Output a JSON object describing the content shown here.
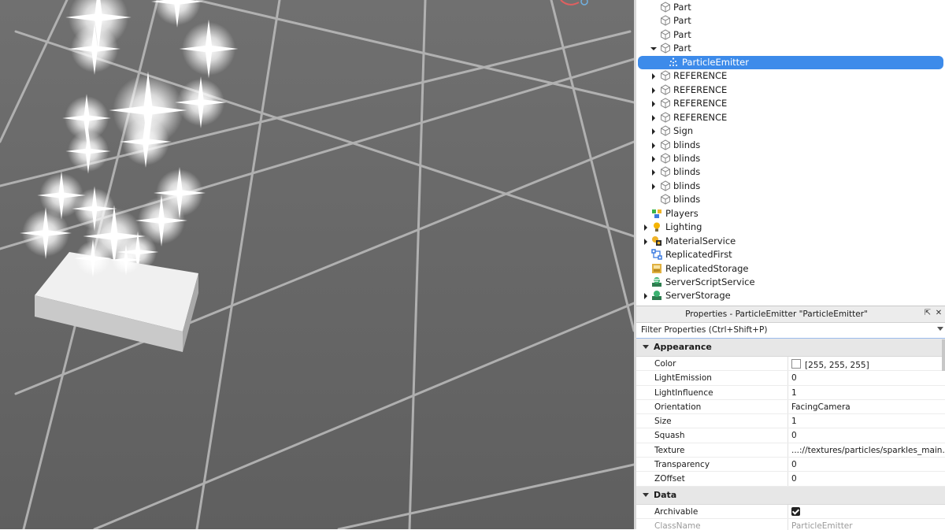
{
  "explorer": {
    "items": [
      {
        "label": "Part",
        "icon": "part-icon",
        "expander": "none"
      },
      {
        "label": "Part",
        "icon": "part-icon",
        "expander": "none"
      },
      {
        "label": "Part",
        "icon": "part-icon",
        "expander": "none"
      },
      {
        "label": "Part",
        "icon": "part-icon",
        "expander": "expanded"
      },
      {
        "label": "ParticleEmitter",
        "icon": "particle-emitter-icon",
        "expander": "none",
        "selected": true
      },
      {
        "label": "REFERENCE",
        "icon": "part-icon",
        "expander": "collapsed"
      },
      {
        "label": "REFERENCE",
        "icon": "part-icon",
        "expander": "collapsed"
      },
      {
        "label": "REFERENCE",
        "icon": "part-icon",
        "expander": "collapsed"
      },
      {
        "label": "REFERENCE",
        "icon": "part-icon",
        "expander": "collapsed"
      },
      {
        "label": "Sign",
        "icon": "part-icon",
        "expander": "collapsed"
      },
      {
        "label": "blinds",
        "icon": "part-icon",
        "expander": "collapsed"
      },
      {
        "label": "blinds",
        "icon": "part-icon",
        "expander": "collapsed"
      },
      {
        "label": "blinds",
        "icon": "part-icon",
        "expander": "collapsed"
      },
      {
        "label": "blinds",
        "icon": "part-icon",
        "expander": "collapsed"
      },
      {
        "label": "blinds",
        "icon": "part-icon",
        "expander": "none"
      },
      {
        "label": "Players",
        "icon": "players-icon",
        "expander": "none"
      },
      {
        "label": "Lighting",
        "icon": "lighting-icon",
        "expander": "collapsed"
      },
      {
        "label": "MaterialService",
        "icon": "material-service-icon",
        "expander": "collapsed"
      },
      {
        "label": "ReplicatedFirst",
        "icon": "replicated-first-icon",
        "expander": "none"
      },
      {
        "label": "ReplicatedStorage",
        "icon": "replicated-storage-icon",
        "expander": "none"
      },
      {
        "label": "ServerScriptService",
        "icon": "server-script-service-icon",
        "expander": "none"
      },
      {
        "label": "ServerStorage",
        "icon": "server-storage-icon",
        "expander": "collapsed"
      }
    ]
  },
  "properties": {
    "title": "Properties - ParticleEmitter \"ParticleEmitter\"",
    "filter_placeholder": "Filter Properties (Ctrl+Shift+P)",
    "sections": [
      {
        "name": "Appearance",
        "rows": [
          {
            "name": "Color",
            "value": "[255, 255, 255]",
            "swatch": "#ffffff"
          },
          {
            "name": "LightEmission",
            "value": "0"
          },
          {
            "name": "LightInfluence",
            "value": "1"
          },
          {
            "name": "Orientation",
            "value": "FacingCamera"
          },
          {
            "name": "Size",
            "value": "1"
          },
          {
            "name": "Squash",
            "value": "0"
          },
          {
            "name": "Texture",
            "value": "...://textures/particles/sparkles_main.dds"
          },
          {
            "name": "Transparency",
            "value": "0"
          },
          {
            "name": "ZOffset",
            "value": "0"
          }
        ]
      },
      {
        "name": "Data",
        "rows": [
          {
            "name": "Archivable",
            "checkbox": true
          },
          {
            "name": "ClassName",
            "value": "ParticleEmitter"
          }
        ]
      }
    ]
  },
  "colors": {
    "selection": "#3d8bea",
    "viewport_floor": "#6e6e6e"
  }
}
